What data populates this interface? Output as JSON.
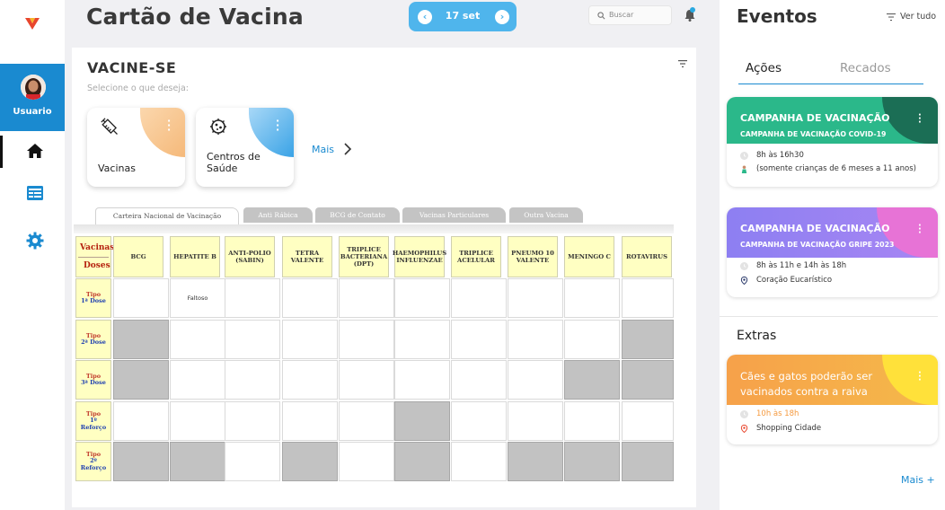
{
  "app": {
    "title": "Cartão de Vacina"
  },
  "date_nav": {
    "label": "17 set",
    "prev": "‹",
    "next": "›"
  },
  "search": {
    "placeholder": "Buscar"
  },
  "sidebar": {
    "user_label": "Usuario",
    "items": [
      {
        "icon": "home-icon"
      },
      {
        "icon": "card-icon"
      },
      {
        "icon": "gear-icon"
      }
    ]
  },
  "main": {
    "title": "VACINE-SE",
    "subtitle": "Selecione o que deseja:",
    "tiles": [
      {
        "label": "Vacinas",
        "icon": "syringe-icon",
        "color": "#f9c48e"
      },
      {
        "label": "Centros de Saúde",
        "icon": "virus-icon",
        "color": "#3aa3e6"
      }
    ],
    "more_label": "Mais",
    "tabs": [
      "Carteira Nacional de Vacinação",
      "Anti Rábica",
      "BCG de Contato",
      "Vacinas Particulares",
      "Outra Vacina"
    ],
    "table": {
      "corner_top": "Vacinas",
      "corner_bottom": "Doses",
      "columns": [
        "BCG",
        "HEPATITE B",
        "ANTI-POLIO (SABIN)",
        "TETRA VALENTE",
        "TRIPLICE BACTERIANA (DPT)",
        "HAEMOPHILUS INFLUENZAE",
        "TRIPLICE ACELULAR",
        "PNEUMO 10 VALENTE",
        "MENINGO C",
        "ROTAVIRUS"
      ],
      "rows": [
        {
          "tipo": "Tipo",
          "dose": "1ª Dose",
          "cells": [
            "",
            "Faltoso",
            "",
            "",
            "",
            "",
            "",
            "",
            "",
            ""
          ],
          "grey": [
            0,
            0,
            0,
            0,
            0,
            0,
            0,
            0,
            0,
            0
          ]
        },
        {
          "tipo": "Tipo",
          "dose": "2ª Dose",
          "cells": [
            "",
            "",
            "",
            "",
            "",
            "",
            "",
            "",
            "",
            ""
          ],
          "grey": [
            1,
            0,
            0,
            0,
            0,
            0,
            0,
            0,
            0,
            1
          ]
        },
        {
          "tipo": "Tipo",
          "dose": "3ª Dose",
          "cells": [
            "",
            "",
            "",
            "",
            "",
            "",
            "",
            "",
            "",
            ""
          ],
          "grey": [
            1,
            0,
            0,
            0,
            0,
            0,
            0,
            0,
            1,
            1
          ]
        },
        {
          "tipo": "Tipo",
          "dose": "1º Reforço",
          "cells": [
            "",
            "",
            "",
            "",
            "",
            "",
            "",
            "",
            "",
            ""
          ],
          "grey": [
            0,
            0,
            0,
            0,
            0,
            1,
            0,
            0,
            0,
            0
          ]
        },
        {
          "tipo": "Tipo",
          "dose": "2º Reforço",
          "cells": [
            "",
            "",
            "",
            "",
            "",
            "",
            "",
            "",
            "",
            ""
          ],
          "grey": [
            1,
            1,
            0,
            1,
            0,
            1,
            0,
            1,
            1,
            1
          ]
        }
      ]
    }
  },
  "events": {
    "title": "Eventos",
    "view_all": "Ver tudo",
    "tabs": {
      "acoes": "Ações",
      "recados": "Recados"
    },
    "cards": [
      {
        "title": "CAMPANHA DE VACINAÇÃO",
        "subtitle": "CAMPANHA DE VACINAÇÃO COVID-19",
        "time": "8h às 16h30",
        "note": "(somente crianças de 6 meses a 11 anos)",
        "note_icon": "child-icon",
        "color": "#2bb88a",
        "accent": "#1b6e55"
      },
      {
        "title": "CAMPANHA DE VACINAÇÃO",
        "subtitle": "CAMPANHA DE VACINAÇÃO GRIPE 2023",
        "time": "8h às 11h e 14h às 18h",
        "note": "Coração Eucarístico",
        "note_icon": "location-icon",
        "color": "#8c7cf0",
        "accent": "#e773d6"
      }
    ],
    "extras_title": "Extras",
    "extras": [
      {
        "title_line1": "Cães e gatos poderão ser",
        "title_line2": "vacinados contra a raiva",
        "time": "10h às 18h",
        "place": "Shopping Cidade",
        "color": "#f59a3f",
        "accent": "#ffe13a"
      }
    ],
    "more": "Mais +"
  }
}
